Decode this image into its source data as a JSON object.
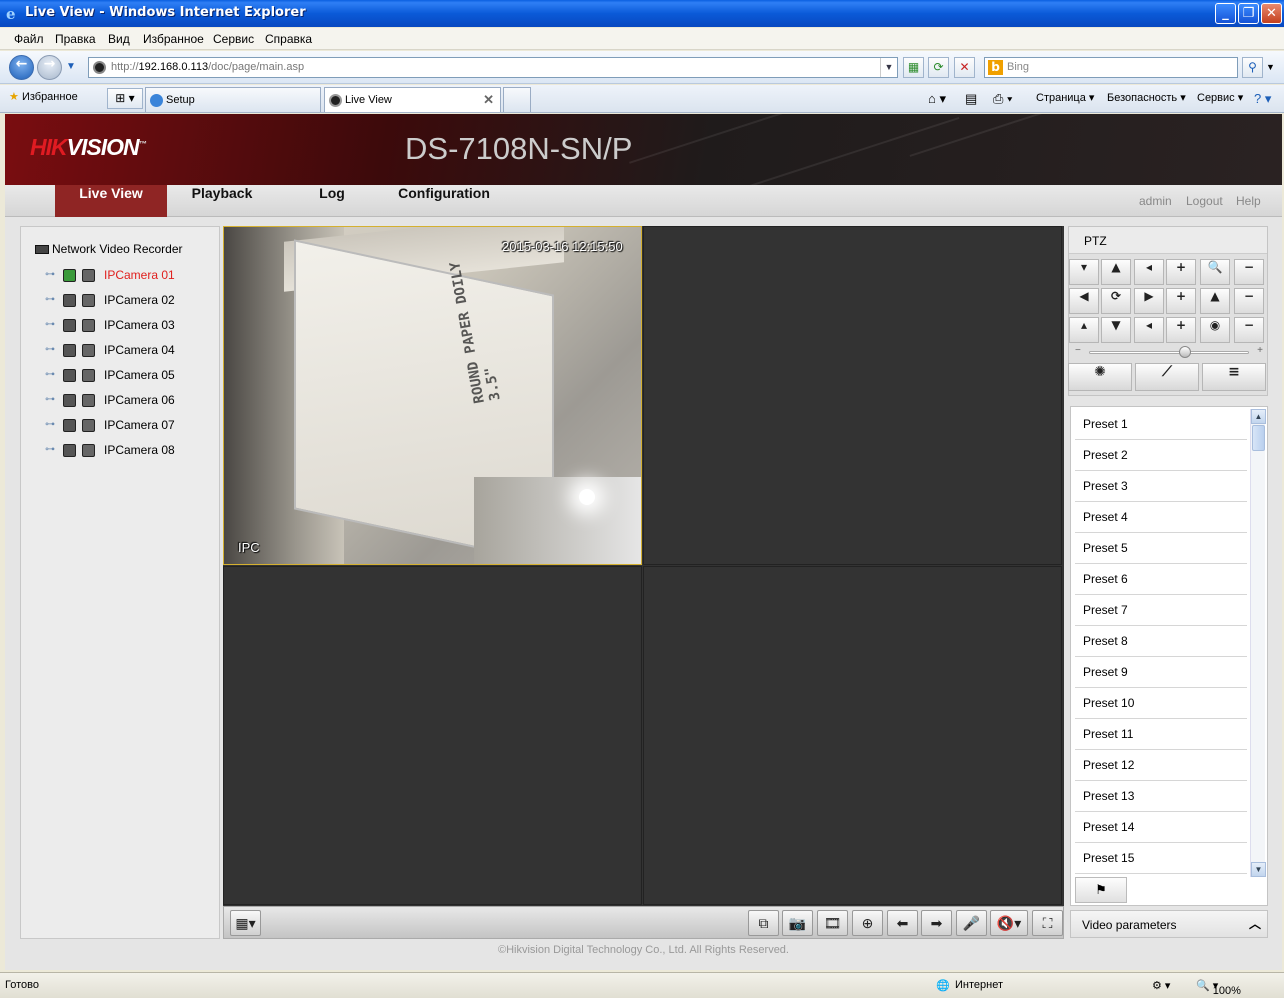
{
  "window": {
    "title": "Live View - Windows Internet Explorer"
  },
  "menu": [
    "Файл",
    "Правка",
    "Вид",
    "Избранное",
    "Сервис",
    "Справка"
  ],
  "address": {
    "url_prefix": "http://",
    "url_host": "192.168.0.113",
    "url_path": "/doc/page/main.asp",
    "search_placeholder": "Bing"
  },
  "favorites_label": "Избранное",
  "tabs": [
    {
      "label": "Setup"
    },
    {
      "label": "Live View"
    }
  ],
  "toolbar_right": {
    "page": "Страница ▾",
    "security": "Безопасность ▾",
    "tools": "Сервис ▾"
  },
  "app": {
    "brand_red": "HIK",
    "brand_white": "VISION",
    "model": "DS-7108N-SN/P",
    "nav": [
      "Live View",
      "Playback",
      "Log",
      "Configuration"
    ],
    "active_nav": "Live View",
    "user": "admin",
    "logout": "Logout",
    "help": "Help",
    "accent_color": "#8f2524"
  },
  "tree": {
    "root": "Network Video Recorder",
    "cameras": [
      "IPCamera 01",
      "IPCamera 02",
      "IPCamera 03",
      "IPCamera 04",
      "IPCamera 05",
      "IPCamera 06",
      "IPCamera 07",
      "IPCamera 08"
    ],
    "active_camera": "IPCamera 01"
  },
  "video": {
    "osd_time": "2015-03-16 12:15:50",
    "osd_name": "IPC",
    "box_text": "ROUND PAPER DOILY 3.5\""
  },
  "ptz": {
    "title": "PTZ",
    "speed_level": 0.6,
    "presets": [
      "Preset 1",
      "Preset 2",
      "Preset 3",
      "Preset 4",
      "Preset 5",
      "Preset 6",
      "Preset 7",
      "Preset 8",
      "Preset 9",
      "Preset 10",
      "Preset 11",
      "Preset 12",
      "Preset 13",
      "Preset 14",
      "Preset 15"
    ],
    "video_params": "Video parameters"
  },
  "copyright": "©Hikvision Digital Technology Co., Ltd. All Rights Reserved.",
  "status": {
    "ready": "Готово",
    "zone": "Интернет",
    "zoom": "100%"
  }
}
